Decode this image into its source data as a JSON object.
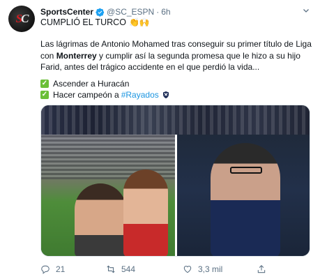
{
  "account": {
    "name": "SportsCenter",
    "handle": "@SC_ESPN",
    "separator": "·",
    "time": "6h",
    "avatar_logo_left": "S",
    "avatar_logo_right": "C"
  },
  "tweet": {
    "headline": "CUMPLIÓ EL TURCO",
    "headline_emoji": "👏🙌",
    "body_part1": "Las lágrimas de Antonio Mohamed tras conseguir su primer título de Liga con ",
    "body_bold": "Monterrey",
    "body_part2": " y cumplir así la segunda promesa que le hizo a su hijo Farid, antes del trágico accidente en el que perdió la vida...",
    "list": [
      {
        "text": "Ascender a Huracán"
      },
      {
        "text": "Hacer campeón a ",
        "hashtag": "#Rayados"
      }
    ]
  },
  "actions": {
    "replies": "21",
    "retweets": "544",
    "likes": "3,3 mil"
  },
  "icons": {
    "verified": "verified-icon",
    "caret": "chevron-down-icon",
    "reply": "reply-icon",
    "retweet": "retweet-icon",
    "like": "heart-icon",
    "share": "share-icon"
  },
  "colors": {
    "accent": "#1b95e0",
    "check": "#6bbf38",
    "muted": "#5b7083"
  }
}
